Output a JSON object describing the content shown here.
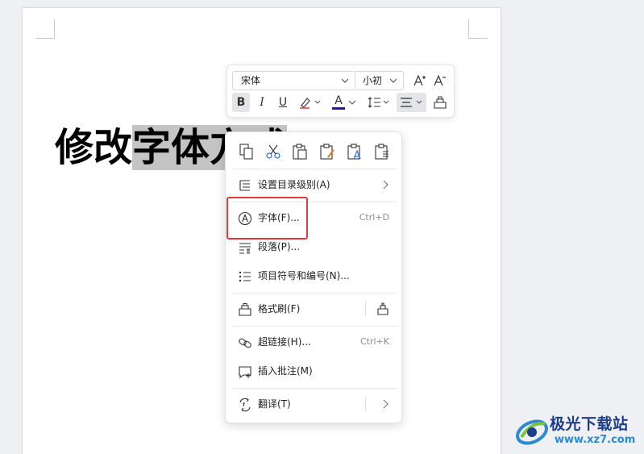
{
  "document": {
    "text_before": "修改",
    "text_selected": "字体",
    "text_hidden": "方式"
  },
  "mini_toolbar": {
    "font_name": "宋体",
    "font_size": "小初",
    "increase_font": "A⁺",
    "decrease_font": "A⁻",
    "bold": "B",
    "italic": "I",
    "underline": "U",
    "font_color_letter": "A",
    "font_color": "#1a1aa8"
  },
  "context_menu": {
    "clipboard_icons": [
      "copy-icon",
      "cut-icon",
      "paste-icon",
      "paste-keep-format-icon",
      "paste-text-only-icon",
      "paste-special-icon"
    ],
    "items": [
      {
        "label": "设置目录级别(A)",
        "icon": "toc-level-icon",
        "submenu": true
      },
      {
        "label": "字体(F)...",
        "icon": "font-circle-a-icon",
        "shortcut": "Ctrl+D"
      },
      {
        "label": "段落(P)...",
        "icon": "paragraph-icon"
      },
      {
        "label": "项目符号和编号(N)...",
        "icon": "bullet-list-icon"
      },
      {
        "label": "格式刷(F)",
        "icon": "format-painter-icon"
      },
      {
        "label": "超链接(H)...",
        "icon": "link-icon",
        "shortcut": "Ctrl+K"
      },
      {
        "label": "插入批注(M)",
        "icon": "comment-icon"
      },
      {
        "label": "翻译(T)",
        "icon": "translate-icon",
        "submenu": true
      }
    ]
  },
  "watermark": {
    "title": "极光下载站",
    "url": "www.xz7.com"
  },
  "colors": {
    "highlight_box": "#e53935",
    "selection": "#c4c4c4"
  }
}
